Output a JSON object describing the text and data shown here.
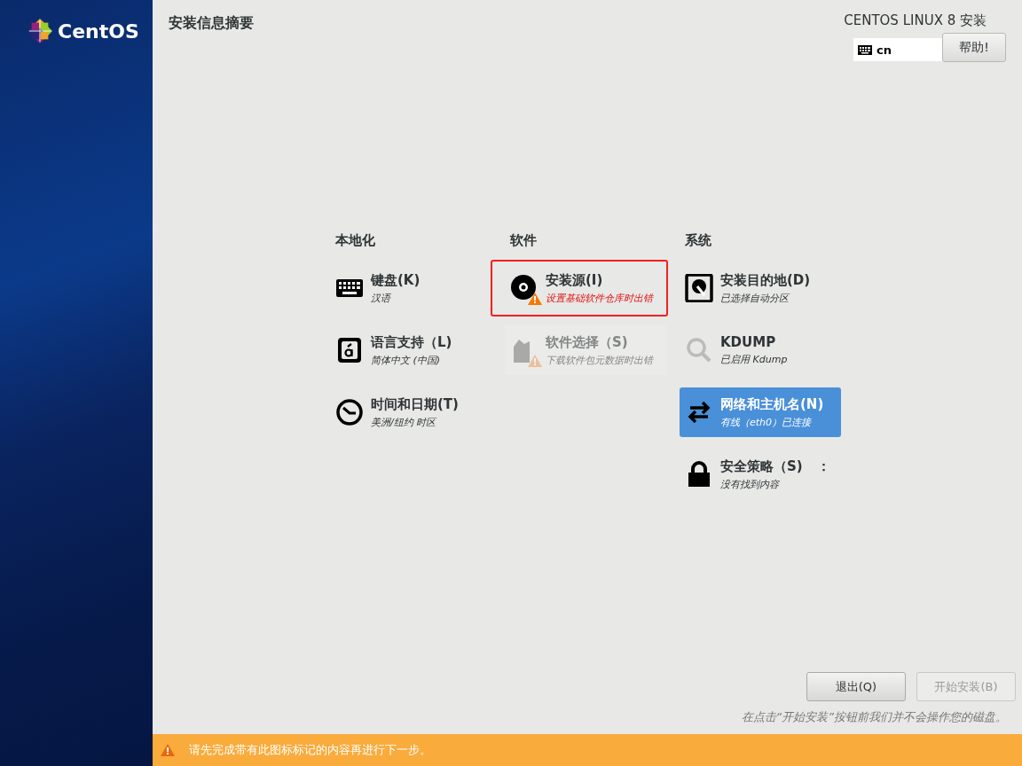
{
  "sidebar": {
    "logo_text": "CentOS"
  },
  "header": {
    "title": "安装信息摘要",
    "product": "CENTOS LINUX 8 安装",
    "keyboard_layout": "cn",
    "help_button": "帮助!"
  },
  "columns": [
    {
      "heading": "本地化",
      "items": [
        {
          "kind": "keyboard",
          "title": "键盘(K)",
          "status": "汉语",
          "warning": false,
          "disabled": false,
          "selected": false,
          "error": false,
          "outlined": false
        },
        {
          "kind": "language",
          "title": "语言支持（L)",
          "status": "简体中文 (中国)",
          "warning": false,
          "disabled": false,
          "selected": false,
          "error": false,
          "outlined": false
        },
        {
          "kind": "clock",
          "title": "时间和日期(T)",
          "status": "美洲/纽约 时区",
          "warning": false,
          "disabled": false,
          "selected": false,
          "error": false,
          "outlined": false
        }
      ]
    },
    {
      "heading": "软件",
      "items": [
        {
          "kind": "disc",
          "title": "安装源(I)",
          "status": "设置基础软件仓库时出错",
          "warning": true,
          "disabled": false,
          "selected": false,
          "error": true,
          "outlined": true
        },
        {
          "kind": "package",
          "title": "软件选择（S)",
          "status": "下载软件包元数据时出错",
          "warning": true,
          "disabled": true,
          "selected": false,
          "error": false,
          "outlined": false
        }
      ]
    },
    {
      "heading": "系统",
      "items": [
        {
          "kind": "disk",
          "title": "安装目的地(D)",
          "status": "已选择自动分区",
          "warning": false,
          "disabled": false,
          "selected": false,
          "error": false,
          "outlined": false
        },
        {
          "kind": "search",
          "title": "KDUMP",
          "status": "已启用 Kdump",
          "warning": false,
          "disabled": false,
          "selected": false,
          "error": false,
          "outlined": false
        },
        {
          "kind": "network",
          "title": "网络和主机名(N)",
          "status": "有线（eth0）已连接",
          "warning": false,
          "disabled": false,
          "selected": true,
          "error": false,
          "outlined": false
        },
        {
          "kind": "lock",
          "title": "安全策略（S)",
          "trailing": "：",
          "status": "没有找到内容",
          "warning": false,
          "disabled": false,
          "selected": false,
          "error": false,
          "outlined": false
        }
      ]
    }
  ],
  "buttons": [
    {
      "label": "退出(Q)",
      "disabled": false
    },
    {
      "label": "开始安装(B)",
      "disabled": true
    }
  ],
  "note": "在点击“开始安装”按钮前我们并不会操作您的磁盘。",
  "warning_bar": {
    "text": "请先完成带有此图标标记的内容再进行下一步。"
  }
}
